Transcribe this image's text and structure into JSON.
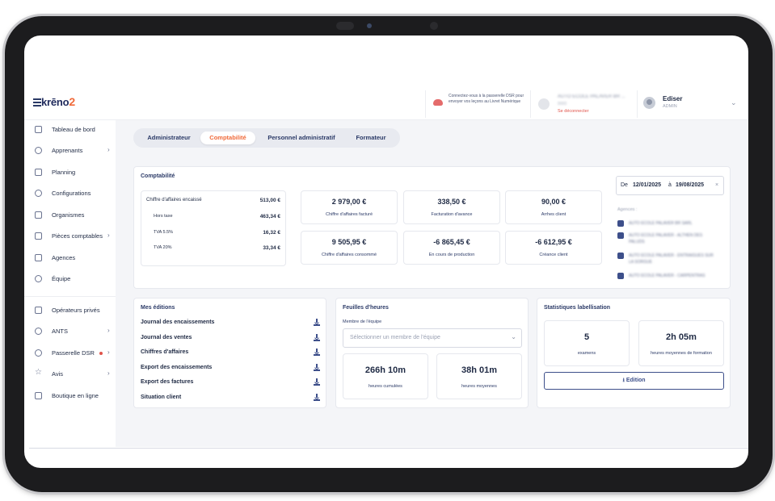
{
  "header": {
    "logo": "krēno",
    "logo_suffix": "2",
    "dsr_notice": "Connectez-vous à la passerelle DSR pour envoyer vos leçons au Livret Numérique",
    "school_name": "AUTO ECOLE PALAVER BR ...",
    "school_sub": "0000",
    "logout": "Se déconnecter",
    "user_name": "Ediser",
    "user_role": "ADMIN"
  },
  "sidebar": {
    "items": [
      {
        "label": "Tableau de bord",
        "icon": "dashboard-icon"
      },
      {
        "label": "Apprenants",
        "icon": "user-icon",
        "arrow": true
      },
      {
        "label": "Planning",
        "icon": "calendar-icon"
      },
      {
        "label": "Configurations",
        "icon": "gear-icon"
      },
      {
        "label": "Organismes",
        "icon": "building-icon"
      },
      {
        "label": "Pièces comptables",
        "icon": "document-icon",
        "arrow": true
      },
      {
        "label": "Agences",
        "icon": "office-icon"
      },
      {
        "label": "Équipe",
        "icon": "team-icon"
      },
      {
        "label": "Opérateurs privés",
        "icon": "operator-icon"
      },
      {
        "label": "ANTS",
        "icon": "cloud-icon",
        "arrow": true
      },
      {
        "label": "Passerelle DSR",
        "icon": "cloud-icon",
        "arrow": true,
        "dot": true
      },
      {
        "label": "Avis",
        "icon": "star-icon",
        "arrow": true
      },
      {
        "label": "Boutique en ligne",
        "icon": "cart-icon"
      }
    ]
  },
  "tabs": [
    "Administrateur",
    "Comptabilité",
    "Personnel administratif",
    "Formateur"
  ],
  "comptabilite": {
    "title": "Comptabilité",
    "ca_rows": [
      {
        "label": "Chiffre d'affaires encaissé",
        "value": "513,00 €"
      },
      {
        "label": "Hors taxe",
        "value": "463,34 €"
      },
      {
        "label": "TVA 5.5%",
        "value": "16,32 €"
      },
      {
        "label": "TVA 20%",
        "value": "33,34 €"
      }
    ],
    "kpis": [
      {
        "value": "2 979,00 €",
        "label": "Chiffre d'affaires facturé"
      },
      {
        "value": "338,50 €",
        "label": "Facturation d'avance"
      },
      {
        "value": "90,00 €",
        "label": "Arrhes client"
      },
      {
        "value": "9 505,95 €",
        "label": "Chiffre d'affaires consommé"
      },
      {
        "value": "-6 865,45 €",
        "label": "En cours de production"
      },
      {
        "value": "-6 612,95 €",
        "label": "Créance client"
      }
    ],
    "date_prefix": "De",
    "date_from": "12/01/2025",
    "date_sep": "à",
    "date_to": "19/08/2025",
    "clear": "×",
    "agences_label": "Agences :",
    "agences": [
      "AUTO ECOLE PALAVER BR SARL",
      "AUTO ECOLE PALAVER - ALTHEN DES PALUDS",
      "AUTO ECOLE PALAVER - ENTRAIGUES SUR LA SORGUE",
      "AUTO ECOLE PALAVER - CARPENTRAS"
    ]
  },
  "editions": {
    "title": "Mes éditions",
    "items": [
      "Journal des encaissements",
      "Journal des ventes",
      "Chiffres d'affaires",
      "Export des encaissements",
      "Export des factures",
      "Situation client"
    ]
  },
  "feuilles": {
    "title": "Feuilles d'heures",
    "field_label": "Membre de l'équipe",
    "placeholder": "Sélectionner un membre de l'équipe",
    "stats": [
      {
        "value": "266h 10m",
        "label": "heures cumulées"
      },
      {
        "value": "38h 01m",
        "label": "heures moyennes"
      }
    ]
  },
  "labellisation": {
    "title": "Statistiques labellisation",
    "stats": [
      {
        "value": "5",
        "label": "examens"
      },
      {
        "value": "2h 05m",
        "label": "heures moyennes de formation"
      }
    ],
    "button": "Edition"
  }
}
